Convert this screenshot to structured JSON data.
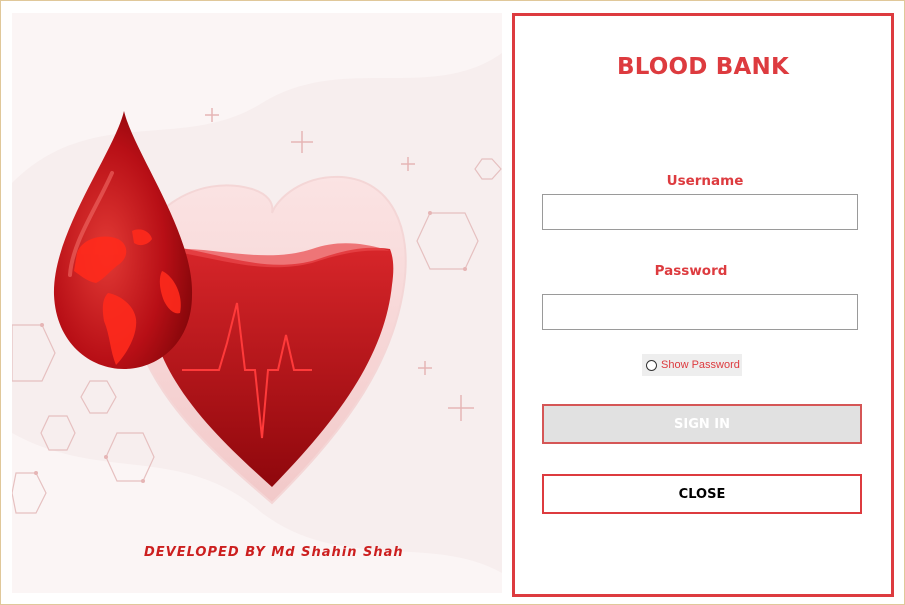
{
  "illustration": {
    "developer_credit": "DEVELOPED BY Md Shahin Shah"
  },
  "login": {
    "title": "BLOOD BANK",
    "username_label": "Username",
    "username_value": "",
    "password_label": "Password",
    "password_value": "",
    "show_password_label": "Show Password",
    "show_password_checked": false,
    "sign_in_label": "SIGN IN",
    "sign_in_enabled": false,
    "close_label": "CLOSE"
  },
  "colors": {
    "accent": "#dd3b3f",
    "blood_red": "#c4141b",
    "panel_background": "#f7eeee"
  }
}
